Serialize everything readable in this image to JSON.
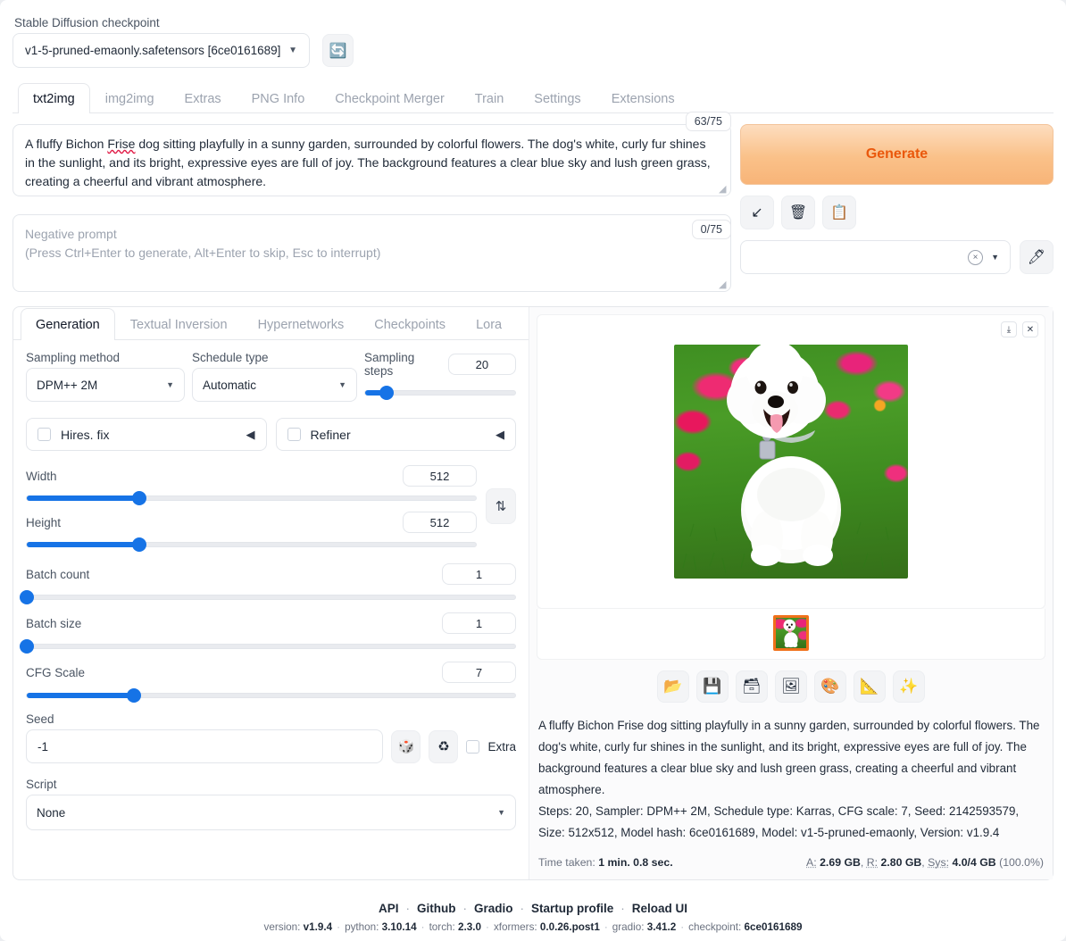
{
  "checkpoint": {
    "label": "Stable Diffusion checkpoint",
    "value": "v1-5-pruned-emaonly.safetensors [6ce0161689]",
    "refresh_icon": "🔄"
  },
  "main_tabs": [
    {
      "label": "txt2img",
      "active": true
    },
    {
      "label": "img2img",
      "active": false
    },
    {
      "label": "Extras",
      "active": false
    },
    {
      "label": "PNG Info",
      "active": false
    },
    {
      "label": "Checkpoint Merger",
      "active": false
    },
    {
      "label": "Train",
      "active": false
    },
    {
      "label": "Settings",
      "active": false
    },
    {
      "label": "Extensions",
      "active": false
    }
  ],
  "prompt": {
    "counter": "63/75",
    "text_part1": "A fluffy Bichon ",
    "text_misspelled": "Frise",
    "text_part2": " dog sitting playfully in a sunny garden, surrounded by colorful flowers. The dog's white, curly fur shines in the sunlight, and its bright, expressive eyes are full of joy. The background features a clear blue sky and lush green grass, creating a cheerful and vibrant atmosphere."
  },
  "negative_prompt": {
    "counter": "0/75",
    "placeholder_line1": "Negative prompt",
    "placeholder_line2": "(Press Ctrl+Enter to generate, Alt+Enter to skip, Esc to interrupt)"
  },
  "generate": {
    "label": "Generate",
    "accent_color": "#ea580c"
  },
  "mini_buttons": [
    {
      "name": "arrow-down-left-icon",
      "glyph": "↙"
    },
    {
      "name": "trash-icon",
      "glyph": "🗑"
    },
    {
      "name": "clipboard-icon",
      "glyph": "📋"
    }
  ],
  "styles": {
    "value": "",
    "clear_glyph": "×",
    "caret_glyph": "▼",
    "edit_glyph": "🖊"
  },
  "sub_tabs": [
    {
      "label": "Generation",
      "active": true
    },
    {
      "label": "Textual Inversion",
      "active": false
    },
    {
      "label": "Hypernetworks",
      "active": false
    },
    {
      "label": "Checkpoints",
      "active": false
    },
    {
      "label": "Lora",
      "active": false
    }
  ],
  "settings": {
    "sampling_method": {
      "label": "Sampling method",
      "value": "DPM++ 2M"
    },
    "schedule_type": {
      "label": "Schedule type",
      "value": "Automatic"
    },
    "sampling_steps": {
      "label": "Sampling steps",
      "value": "20",
      "percent": 14
    },
    "hires_fix": {
      "label": "Hires. fix",
      "checked": false,
      "arrow": "◀"
    },
    "refiner": {
      "label": "Refiner",
      "checked": false,
      "arrow": "◀"
    },
    "width": {
      "label": "Width",
      "value": "512",
      "percent": 25
    },
    "height": {
      "label": "Height",
      "value": "512",
      "percent": 25
    },
    "swap_glyph": "⇅",
    "batch_count": {
      "label": "Batch count",
      "value": "1",
      "percent": 0
    },
    "batch_size": {
      "label": "Batch size",
      "value": "1",
      "percent": 0
    },
    "cfg_scale": {
      "label": "CFG Scale",
      "value": "7",
      "percent": 22
    },
    "seed": {
      "label": "Seed",
      "value": "-1",
      "dice_glyph": "🎲",
      "recycle_glyph": "♻",
      "extra_label": "Extra",
      "extra_checked": false
    },
    "script": {
      "label": "Script",
      "value": "None"
    }
  },
  "result": {
    "download_glyph": "⤓",
    "close_glyph": "✕",
    "tool_buttons": [
      {
        "name": "open-folder-icon",
        "glyph": "📂"
      },
      {
        "name": "save-icon",
        "glyph": "💾"
      },
      {
        "name": "save-zip-icon",
        "glyph": "🗃"
      },
      {
        "name": "send-to-img2img-icon",
        "glyph": "🖼"
      },
      {
        "name": "send-to-inpaint-icon",
        "glyph": "🎨"
      },
      {
        "name": "send-to-extras-icon",
        "glyph": "📐"
      },
      {
        "name": "send-to-other-icon",
        "glyph": "✨"
      }
    ],
    "description": "A fluffy Bichon Frise dog sitting playfully in a sunny garden, surrounded by colorful flowers. The dog's white, curly fur shines in the sunlight, and its bright, expressive eyes are full of joy. The background features a clear blue sky and lush green grass, creating a cheerful and vibrant atmosphere.",
    "params": "Steps: 20, Sampler: DPM++ 2M, Schedule type: Karras, CFG scale: 7, Seed: 2142593579, Size: 512x512, Model hash: 6ce0161689, Model: v1-5-pruned-emaonly, Version: v1.9.4",
    "time_label": "Time taken:",
    "time_value": "1 min. 0.8 sec.",
    "mem_a_label": "A:",
    "mem_a_value": "2.69 GB",
    "mem_r_label": "R:",
    "mem_r_value": "2.80 GB",
    "mem_sys_label": "Sys:",
    "mem_sys_value": "4.0/4 GB",
    "mem_sys_pct": "(100.0%)"
  },
  "footer": {
    "links": [
      "API",
      "Github",
      "Gradio",
      "Startup profile",
      "Reload UI"
    ],
    "version_label": "version:",
    "version_value": "v1.9.4",
    "python_label": "python:",
    "python_value": "3.10.14",
    "torch_label": "torch:",
    "torch_value": "2.3.0",
    "xformers_label": "xformers:",
    "xformers_value": "0.0.26.post1",
    "gradio_label": "gradio:",
    "gradio_value": "3.41.2",
    "checkpoint_label": "checkpoint:",
    "checkpoint_value": "6ce0161689"
  }
}
